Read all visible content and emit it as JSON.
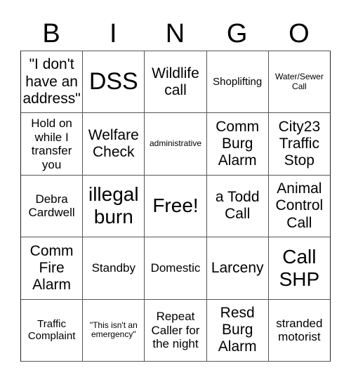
{
  "header": {
    "letters": [
      "B",
      "I",
      "N",
      "G",
      "O"
    ]
  },
  "board": {
    "cells": [
      [
        "\"I don't have an address\"",
        "DSS",
        "Wildlife call",
        "Shoplifting",
        "Water/Sewer Call"
      ],
      [
        "Hold on while I transfer you",
        "Welfare Check",
        "administrative",
        "Comm Burg Alarm",
        "City23 Traffic Stop"
      ],
      [
        "Debra Cardwell",
        "illegal burn",
        "Free!",
        "a Todd Call",
        "Animal Control Call"
      ],
      [
        "Comm Fire Alarm",
        "Standby",
        "Domestic",
        "Larceny",
        "Call SHP"
      ],
      [
        "Traffic Complaint",
        "\"This isn't an emergency\"",
        "Repeat Caller for the night",
        "Resd Burg Alarm",
        "stranded motorist"
      ]
    ],
    "free_space": "Free!"
  }
}
